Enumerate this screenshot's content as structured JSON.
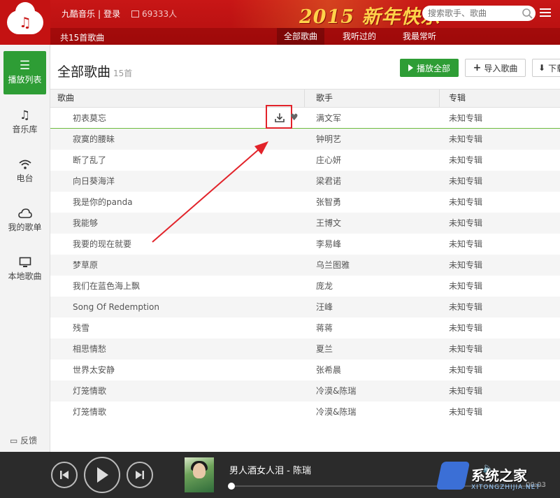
{
  "header": {
    "brand": "九酷音乐",
    "login": "登录",
    "listeners": "69333人",
    "banner": "2015 新年快乐",
    "search_placeholder": "搜索歌手、歌曲"
  },
  "subnav": {
    "total": "共15首歌曲",
    "tabs": [
      {
        "label": "全部歌曲",
        "active": true
      },
      {
        "label": "我听过的",
        "active": false
      },
      {
        "label": "我最常听",
        "active": false
      }
    ]
  },
  "sidebar": {
    "items": [
      {
        "label": "播放列表",
        "icon": "list-icon",
        "active": true
      },
      {
        "label": "音乐库",
        "icon": "music-note-icon",
        "active": false
      },
      {
        "label": "电台",
        "icon": "wifi-icon",
        "active": false
      },
      {
        "label": "我的歌单",
        "icon": "cloud-icon",
        "active": false
      },
      {
        "label": "本地歌曲",
        "icon": "monitor-icon",
        "active": false
      }
    ],
    "feedback": "反馈"
  },
  "main": {
    "title": "全部歌曲",
    "count": "15首",
    "buttons": {
      "play_all": "播放全部",
      "import": "导入歌曲",
      "download": "下载"
    },
    "columns": {
      "song": "歌曲",
      "artist": "歌手",
      "album": "专辑"
    },
    "rows": [
      {
        "song": "初表莫忘",
        "artist": "满文军",
        "album": "未知专辑"
      },
      {
        "song": "寂寞的腰昧",
        "artist": "钟明艺",
        "album": "未知专辑"
      },
      {
        "song": "断了乱了",
        "artist": "庄心妍",
        "album": "未知专辑"
      },
      {
        "song": "向日葵海洋",
        "artist": "梁君诺",
        "album": "未知专辑"
      },
      {
        "song": "我是你的panda",
        "artist": "张智勇",
        "album": "未知专辑"
      },
      {
        "song": "我能够",
        "artist": "王博文",
        "album": "未知专辑"
      },
      {
        "song": "我要的现在就要",
        "artist": "李易峰",
        "album": "未知专辑"
      },
      {
        "song": "梦草原",
        "artist": "乌兰图雅",
        "album": "未知专辑"
      },
      {
        "song": "我们在蓝色海上飘",
        "artist": "庞龙",
        "album": "未知专辑"
      },
      {
        "song": "Song Of Redemption",
        "artist": "汪峰",
        "album": "未知专辑"
      },
      {
        "song": "残雪",
        "artist": "蒋蒋",
        "album": "未知专辑"
      },
      {
        "song": "相思情愁",
        "artist": "夏兰",
        "album": "未知专辑"
      },
      {
        "song": "世界太安静",
        "artist": "张希晨",
        "album": "未知专辑"
      },
      {
        "song": "灯笼情歌",
        "artist": "冷漠&陈瑞",
        "album": "未知专辑"
      },
      {
        "song": "灯笼情歌",
        "artist": "冷漠&陈瑞",
        "album": "未知专辑"
      }
    ]
  },
  "player": {
    "now_playing": "男人酒女人泪 - 陈瑞",
    "time": "00:03",
    "progress": 0
  },
  "watermark": {
    "text": "系统之家",
    "sub": "XITONGZHIJIA.NET"
  },
  "colors": {
    "header_red": "#c81616",
    "accent_green": "#2e9d35",
    "highlight_red": "#e2232a",
    "player_bg": "#2b2b2b"
  }
}
